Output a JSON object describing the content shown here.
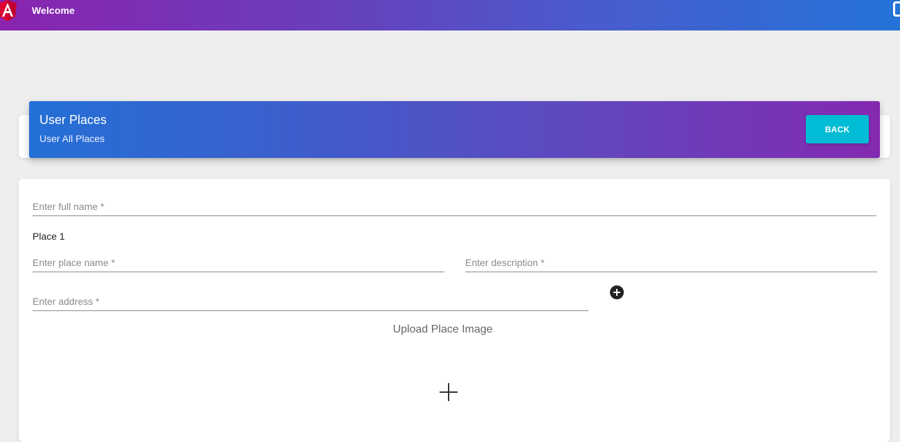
{
  "topbar": {
    "title": "Welcome",
    "logo_icon": "angular-logo-icon",
    "right_icon": "square-outline-icon",
    "gradient_colors": [
      "#8a24b0",
      "#2473d8"
    ]
  },
  "header": {
    "title": "User Places",
    "subtitle": "User All Places",
    "back_label": "BACK",
    "back_color": "#00bcd4",
    "gradient_colors": [
      "#2470d6",
      "#8329b0"
    ]
  },
  "form": {
    "full_name_placeholder": "Enter full name *",
    "place_label": "Place 1",
    "place_name_placeholder": "Enter place name *",
    "description_placeholder": "Enter description *",
    "address_placeholder": "Enter address *",
    "add_place_icon": "add-circle-icon",
    "upload_title": "Upload Place Image",
    "upload_icon": "plus-icon"
  }
}
